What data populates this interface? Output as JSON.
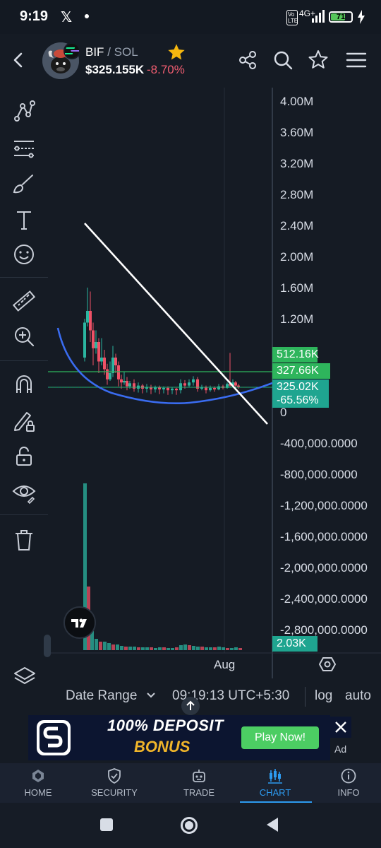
{
  "status_bar": {
    "time": "9:19",
    "x_logo": "𝕏",
    "network_badge": "Vo LTE",
    "network_type": "4G+",
    "battery_level": "71",
    "battery_fraction": 0.71
  },
  "header": {
    "token_symbol": "BIF",
    "pair_separator": "/",
    "quote_symbol": "SOL",
    "price": "$325.155K",
    "change": "-8.70%"
  },
  "chart": {
    "y_axis_labels": [
      "4.00M",
      "3.60M",
      "3.20M",
      "2.80M",
      "2.40M",
      "2.00M",
      "1.60M",
      "1.20M",
      "0",
      "-400,000.0000",
      "-800,000.0000",
      "-1,200,000.0000",
      "-1,600,000.0000",
      "-2,000,000.0000",
      "-2,400,000.0000",
      "-2,800,000.0000"
    ],
    "y_axis_values": [
      4000000,
      3600000,
      3200000,
      2800000,
      2400000,
      2000000,
      1600000,
      1200000,
      0,
      -400000,
      -800000,
      -1200000,
      -1600000,
      -2000000,
      -2400000,
      -2800000
    ],
    "x_axis_label": "Aug",
    "tags": {
      "high_value": "512.16K",
      "mid_value": "327.66K",
      "current_value": "325.02K",
      "current_change": "-65.56%",
      "volume_value": "2.03K"
    },
    "colors": {
      "up": "#2bb5a0",
      "down": "#ef5166",
      "tag_green": "#2eb55c",
      "tag_teal": "#1fa590",
      "trend_line": "#ffffff",
      "curve": "#3a6cf0"
    }
  },
  "controls": {
    "date_range_label": "Date Range",
    "time_label": "09:19:13 UTC+5:30",
    "log_label": "log",
    "auto_label": "auto"
  },
  "ad": {
    "title": "100% DEPOSIT",
    "subtitle": "BONUS",
    "cta": "Play Now!",
    "ad_label": "Ad"
  },
  "bottom_nav": {
    "items": [
      {
        "label": "HOME"
      },
      {
        "label": "SECURITY"
      },
      {
        "label": "TRADE"
      },
      {
        "label": "CHART"
      },
      {
        "label": "INFO"
      }
    ],
    "active": "CHART"
  }
}
